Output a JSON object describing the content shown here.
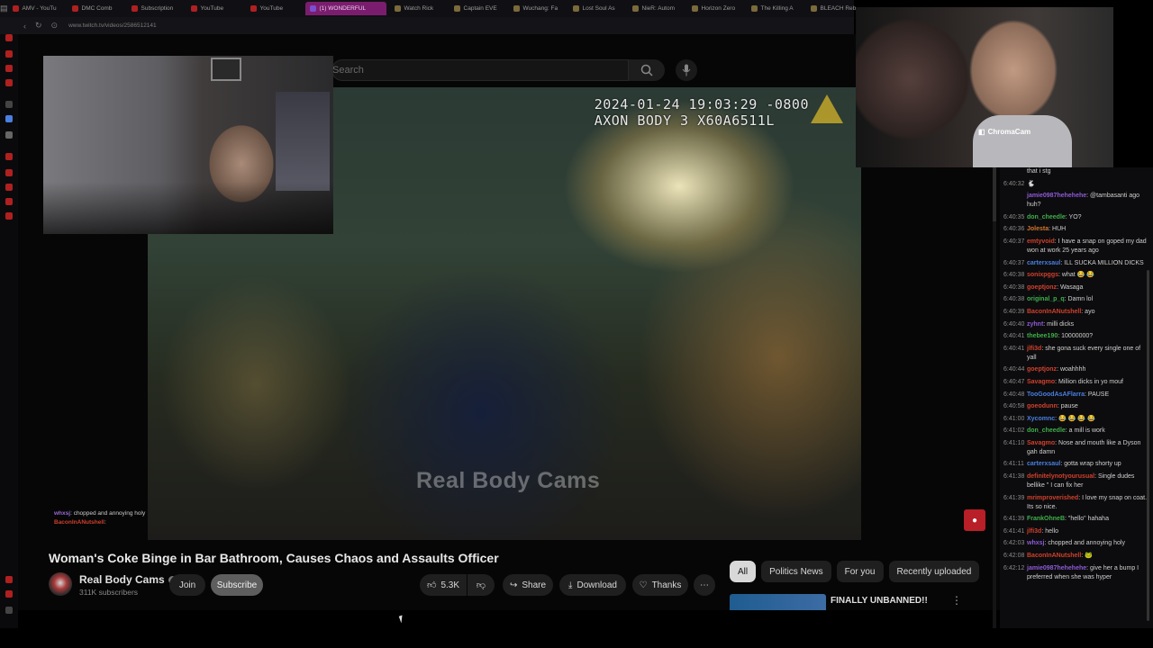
{
  "browser": {
    "tabs": [
      {
        "label": "AMV - YouTu",
        "favicon": "youtube"
      },
      {
        "label": "DMC Comb",
        "favicon": "youtube"
      },
      {
        "label": "Subscription",
        "favicon": "youtube"
      },
      {
        "label": "YouTube",
        "favicon": "youtube"
      },
      {
        "label": "YouTube",
        "favicon": "youtube"
      },
      {
        "label": "(1) WONDERFUL",
        "favicon": "twitch",
        "active": true
      },
      {
        "label": "Watch Rick",
        "favicon": "generic"
      },
      {
        "label": "Captain EVE",
        "favicon": "generic"
      },
      {
        "label": "Wuchang: Fa",
        "favicon": "generic"
      },
      {
        "label": "Lost Soul As",
        "favicon": "generic"
      },
      {
        "label": "NieR: Autom",
        "favicon": "generic"
      },
      {
        "label": "Horizon Zero",
        "favicon": "generic"
      },
      {
        "label": "The Killing A",
        "favicon": "generic"
      },
      {
        "label": "BLEACH Reb",
        "favicon": "generic"
      }
    ],
    "url": "www.twitch.tv/videos/2586512141"
  },
  "youtube": {
    "search_placeholder": "Search",
    "video_timestamp_line1": "2024-01-24 19:03:29 -0800",
    "video_timestamp_line2": "AXON BODY 3 X60A6511L",
    "watermark": "Real Body Cams",
    "title": "Woman's Coke Binge in Bar Bathroom, Causes Chaos and Assaults Officer",
    "channel": {
      "name": "Real Body Cams",
      "subscribers": "311K subscribers"
    },
    "buttons": {
      "join": "Join",
      "subscribe": "Subscribe",
      "likes": "5.3K",
      "share": "Share",
      "download": "Download",
      "thanks": "Thanks",
      "more": "⋯"
    },
    "filter_pills": [
      "All",
      "Politics News",
      "For you",
      "Recently uploaded"
    ],
    "recommended_title": "FINALLY UNBANNED!!"
  },
  "webcam": {
    "label": "ChromaCam"
  },
  "overlay_chat": [
    {
      "user": "whxsj",
      "text": "chopped and annoying holy"
    },
    {
      "user": "BaconInANutshell",
      "text": ""
    }
  ],
  "chat": {
    "colors": {
      "green": "#3fae4a",
      "red": "#d0402c",
      "purple": "#8d5bd6",
      "blue": "#4a7fe0",
      "orange": "#d4772a"
    },
    "messages": [
      {
        "ts": "",
        "user": "",
        "color": "#cfcfcf",
        "text": "that i stg"
      },
      {
        "ts": "6:40:32",
        "user": "",
        "color": "#cfcfcf",
        "text": "🐇"
      },
      {
        "ts": "",
        "user": "jamie0987hehehehe",
        "color": "#8d5bd6",
        "text": ": @tambasanti ago huh?"
      },
      {
        "ts": "6:40:35",
        "user": "don_cheedle",
        "color": "#3fae4a",
        "text": ": YO?"
      },
      {
        "ts": "6:40:36",
        "user": "Jolesta",
        "color": "#d4772a",
        "text": ": HUH"
      },
      {
        "ts": "6:40:37",
        "user": "emtyvoid",
        "color": "#d0402c",
        "text": ": I have a snap on goped my dad won at work 25 years ago"
      },
      {
        "ts": "6:40:37",
        "user": "carterxsaul",
        "color": "#4a7fe0",
        "text": ": ILL SUCKA MILLION DICKS"
      },
      {
        "ts": "6:40:38",
        "user": "sonixpggs",
        "color": "#d0402c",
        "text": ": what 😂 😂"
      },
      {
        "ts": "6:40:38",
        "user": "goeptjonz",
        "color": "#d0402c",
        "text": ": Wasaga"
      },
      {
        "ts": "6:40:38",
        "user": "original_p_q",
        "color": "#3fae4a",
        "text": ": Damn lol"
      },
      {
        "ts": "6:40:39",
        "user": "BaconInANutshell",
        "color": "#d0402c",
        "text": ": ayo"
      },
      {
        "ts": "6:40:40",
        "user": "zyhnt",
        "color": "#8d5bd6",
        "text": ": milli dicks"
      },
      {
        "ts": "6:40:41",
        "user": "thebee190",
        "color": "#3fae4a",
        "text": ": 10000000?"
      },
      {
        "ts": "6:40:41",
        "user": "jlfi3d",
        "color": "#d0402c",
        "text": ": she gona suck every single one of yall"
      },
      {
        "ts": "6:40:44",
        "user": "goeptjonz",
        "color": "#d0402c",
        "text": ": woahhhh"
      },
      {
        "ts": "6:40:47",
        "user": "Savagmo",
        "color": "#d0402c",
        "text": ": Million dicks in yo mouf"
      },
      {
        "ts": "6:40:48",
        "user": "TooGoodAsAFlarra",
        "color": "#4a7fe0",
        "text": ": PAUSE"
      },
      {
        "ts": "6:40:58",
        "user": "goeodunn",
        "color": "#d0402c",
        "text": ": pause"
      },
      {
        "ts": "6:41:00",
        "user": "Xycomnc",
        "color": "#4a7fe0",
        "text": ": 😂 😂 😂 😂"
      },
      {
        "ts": "6:41:02",
        "user": "don_cheedle",
        "color": "#3fae4a",
        "text": ": a mill is work"
      },
      {
        "ts": "6:41:10",
        "user": "Savagmo",
        "color": "#d0402c",
        "text": ": Nose and mouth like a Dyson gah damn"
      },
      {
        "ts": "6:41:11",
        "user": "carterxsaul",
        "color": "#4a7fe0",
        "text": ": gotta wrap shorty up"
      },
      {
        "ts": "6:41:38",
        "user": "definitelynotyourusual",
        "color": "#d0402c",
        "text": ": Single dudes bellike \" I can fix her"
      },
      {
        "ts": "6:41:39",
        "user": "mrimproverished",
        "color": "#d0402c",
        "text": ": I love my snap on coat. Its so nice."
      },
      {
        "ts": "6:41:39",
        "user": "FrankOhneB",
        "color": "#3fae4a",
        "text": ": \"hello\" hahaha"
      },
      {
        "ts": "6:41:41",
        "user": "jlfi3d",
        "color": "#d0402c",
        "text": ": hello"
      },
      {
        "ts": "6:42:03",
        "user": "whxsj",
        "color": "#8d5bd6",
        "text": ": chopped and annoying holy"
      },
      {
        "ts": "6:42:08",
        "user": "BaconInANutshell",
        "color": "#d0402c",
        "text": ": 🐸"
      },
      {
        "ts": "6:42:12",
        "user": "jamie0987hehehehe",
        "color": "#8d5bd6",
        "text": ": give her a bump I preferred when she was hyper"
      }
    ]
  }
}
